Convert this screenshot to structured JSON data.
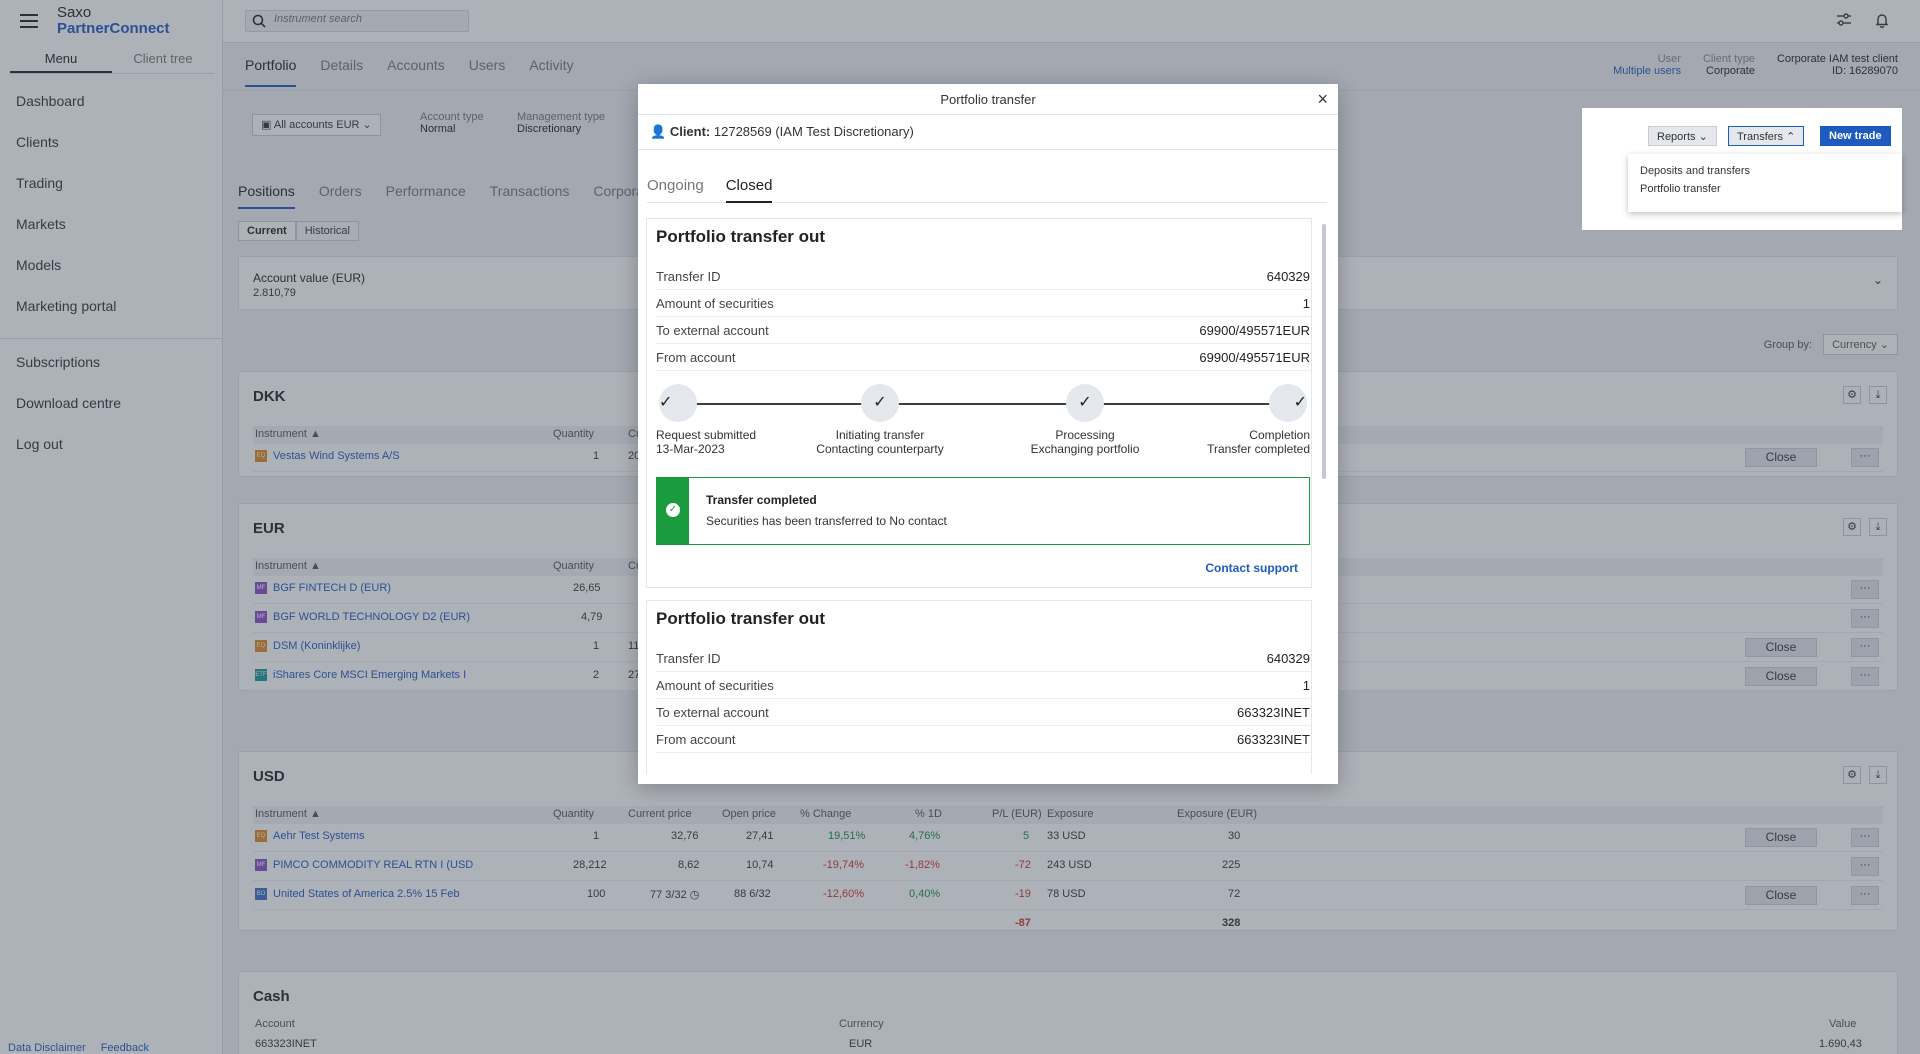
{
  "app": {
    "brand_line1": "Saxo",
    "brand_line2": "PartnerConnect"
  },
  "sidebar": {
    "tabs": [
      "Menu",
      "Client tree"
    ],
    "items": [
      "Dashboard",
      "Clients",
      "Trading",
      "Markets",
      "Models",
      "Marketing portal"
    ],
    "items2": [
      "Subscriptions",
      "Download centre",
      "Log out"
    ],
    "footer": [
      "Data Disclaimer",
      "Feedback"
    ]
  },
  "topbar": {
    "search_placeholder": "Instrument search"
  },
  "nav": {
    "tabs": [
      "Portfolio",
      "Details",
      "Accounts",
      "Users",
      "Activity"
    ],
    "meta": [
      {
        "k": "User",
        "v": "Multiple users"
      },
      {
        "k": "Client type",
        "v": "Corporate"
      },
      {
        "k": "Corporate IAM test client",
        "v": "ID: 16289070"
      }
    ]
  },
  "filter": {
    "accounts": "All accounts",
    "currency": "EUR",
    "account_type_label": "Account type",
    "account_type": "Normal",
    "mgmt_type_label": "Management type",
    "mgmt_type": "Discretionary"
  },
  "position_tabs": [
    "Positions",
    "Orders",
    "Performance",
    "Transactions",
    "Corporate"
  ],
  "segments": [
    "Current",
    "Historical"
  ],
  "account_value": {
    "label": "Account value (EUR)",
    "value": "2.810,79"
  },
  "groupby": {
    "label": "Group by:",
    "value": "Currency"
  },
  "sections": {
    "dkk": {
      "title": "DKK",
      "head": {
        "instrument": "Instrument ▲",
        "quantity": "Quantity",
        "current": "Curre"
      },
      "rows": [
        {
          "badge": "EQ",
          "name": "Vestas Wind Systems A/S",
          "qty": "1",
          "cur": "20"
        }
      ]
    },
    "eur": {
      "title": "EUR",
      "head": {
        "instrument": "Instrument ▲",
        "quantity": "Quantity",
        "current": "Curre"
      },
      "rows": [
        {
          "badge": "MF",
          "name": "BGF FINTECH D (EUR)",
          "qty": "26,65",
          "cur": ""
        },
        {
          "badge": "MF",
          "name": "BGF WORLD TECHNOLOGY D2 (EUR)",
          "qty": "4,79",
          "cur": ""
        },
        {
          "badge": "EQ",
          "name": "DSM (Koninklijke)",
          "qty": "1",
          "cur": "11"
        },
        {
          "badge": "ETF",
          "name": "iShares Core MSCI Emerging Markets I",
          "qty": "2",
          "cur": "27"
        }
      ]
    },
    "usd": {
      "title": "USD",
      "head": {
        "instrument": "Instrument ▲",
        "quantity": "Quantity",
        "current": "Current price",
        "open": "Open price",
        "change": "% Change",
        "d1": "% 1D",
        "pl": "P/L (EUR)",
        "exposure": "Exposure",
        "exposure_eur": "Exposure (EUR)"
      },
      "rows": [
        {
          "badge": "EQ",
          "name": "Aehr Test Systems",
          "qty": "1",
          "cur": "32,76",
          "open": "27,41",
          "change": "19,51%",
          "d1": "4,76%",
          "pl": "5",
          "exposure": "33 USD",
          "exposure_eur": "30"
        },
        {
          "badge": "MF",
          "name": "PIMCO COMMODITY REAL RTN I (USD",
          "qty": "28,212",
          "cur": "8,62",
          "open": "10,74",
          "change": "-19,74%",
          "d1": "-1,82%",
          "pl": "-72",
          "exposure": "243 USD",
          "exposure_eur": "225"
        },
        {
          "badge": "BO",
          "name": "United States of America 2.5% 15 Feb",
          "qty": "100",
          "cur": "77 3/32",
          "open": "88 6/32",
          "change": "-12,60%",
          "d1": "0,40%",
          "pl": "-19",
          "exposure": "78 USD",
          "exposure_eur": "72"
        }
      ],
      "totals": {
        "pl": "-87",
        "exposure_eur": "328"
      }
    },
    "cash": {
      "title": "Cash",
      "head": {
        "account": "Account",
        "currency": "Currency",
        "value": "Value"
      },
      "row": {
        "account": "663323INET",
        "currency": "EUR",
        "value": "1.690,43"
      }
    }
  },
  "buttons": {
    "close": "Close",
    "more": "···",
    "reports": "Reports",
    "transfers": "Transfers",
    "new_trade": "New trade"
  },
  "transfers_menu": [
    "Deposits and transfers",
    "Portfolio transfer"
  ],
  "modal": {
    "title": "Portfolio transfer",
    "client_label": "Client:",
    "client_value": "12728569 (IAM Test Discretionary)",
    "tabs": [
      "Ongoing",
      "Closed"
    ],
    "cards": [
      {
        "title": "Portfolio transfer out",
        "rows": [
          {
            "k": "Transfer ID",
            "v": "640329"
          },
          {
            "k": "Amount of securities",
            "v": "1"
          },
          {
            "k": "To external account",
            "v": "69900/495571EUR"
          },
          {
            "k": "From account",
            "v": "69900/495571EUR"
          }
        ],
        "steps": [
          {
            "t": "Request submitted",
            "s": "13-Mar-2023"
          },
          {
            "t": "Initiating transfer",
            "s": "Contacting counterparty"
          },
          {
            "t": "Processing",
            "s": "Exchanging portfolio"
          },
          {
            "t": "Completion",
            "s": "Transfer completed"
          }
        ],
        "alert_title": "Transfer completed",
        "alert_desc": "Securities has been transferred to No contact",
        "contact": "Contact support"
      },
      {
        "title": "Portfolio transfer out",
        "rows": [
          {
            "k": "Transfer ID",
            "v": "640329"
          },
          {
            "k": "Amount of securities",
            "v": "1"
          },
          {
            "k": "To external account",
            "v": "663323INET"
          },
          {
            "k": "From account",
            "v": "663323INET"
          }
        ]
      }
    ]
  },
  "colors": {
    "accent": "#1f5bbf",
    "success": "#1a9c3e",
    "negative": "#d0342c",
    "positive": "#1a8f3c"
  }
}
